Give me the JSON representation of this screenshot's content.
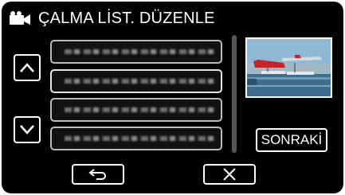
{
  "header": {
    "title": "ÇALMA LİST. DÜZENLE",
    "icon": "video-camera-icon"
  },
  "navigation": {
    "up_icon": "chevron-up-icon",
    "down_icon": "chevron-down-icon"
  },
  "playlist_items": [
    {
      "state": "normal"
    },
    {
      "state": "selected"
    },
    {
      "state": "normal"
    },
    {
      "state": "normal"
    }
  ],
  "preview": {
    "icon": "video-thumbnail"
  },
  "buttons": {
    "next_label": "SONRAKİ",
    "back_icon": "return-arrow-icon",
    "close_icon": "close-icon"
  },
  "colors": {
    "background": "#000000",
    "button_border": "#ffffff",
    "list_border": "#bdbdbd"
  }
}
